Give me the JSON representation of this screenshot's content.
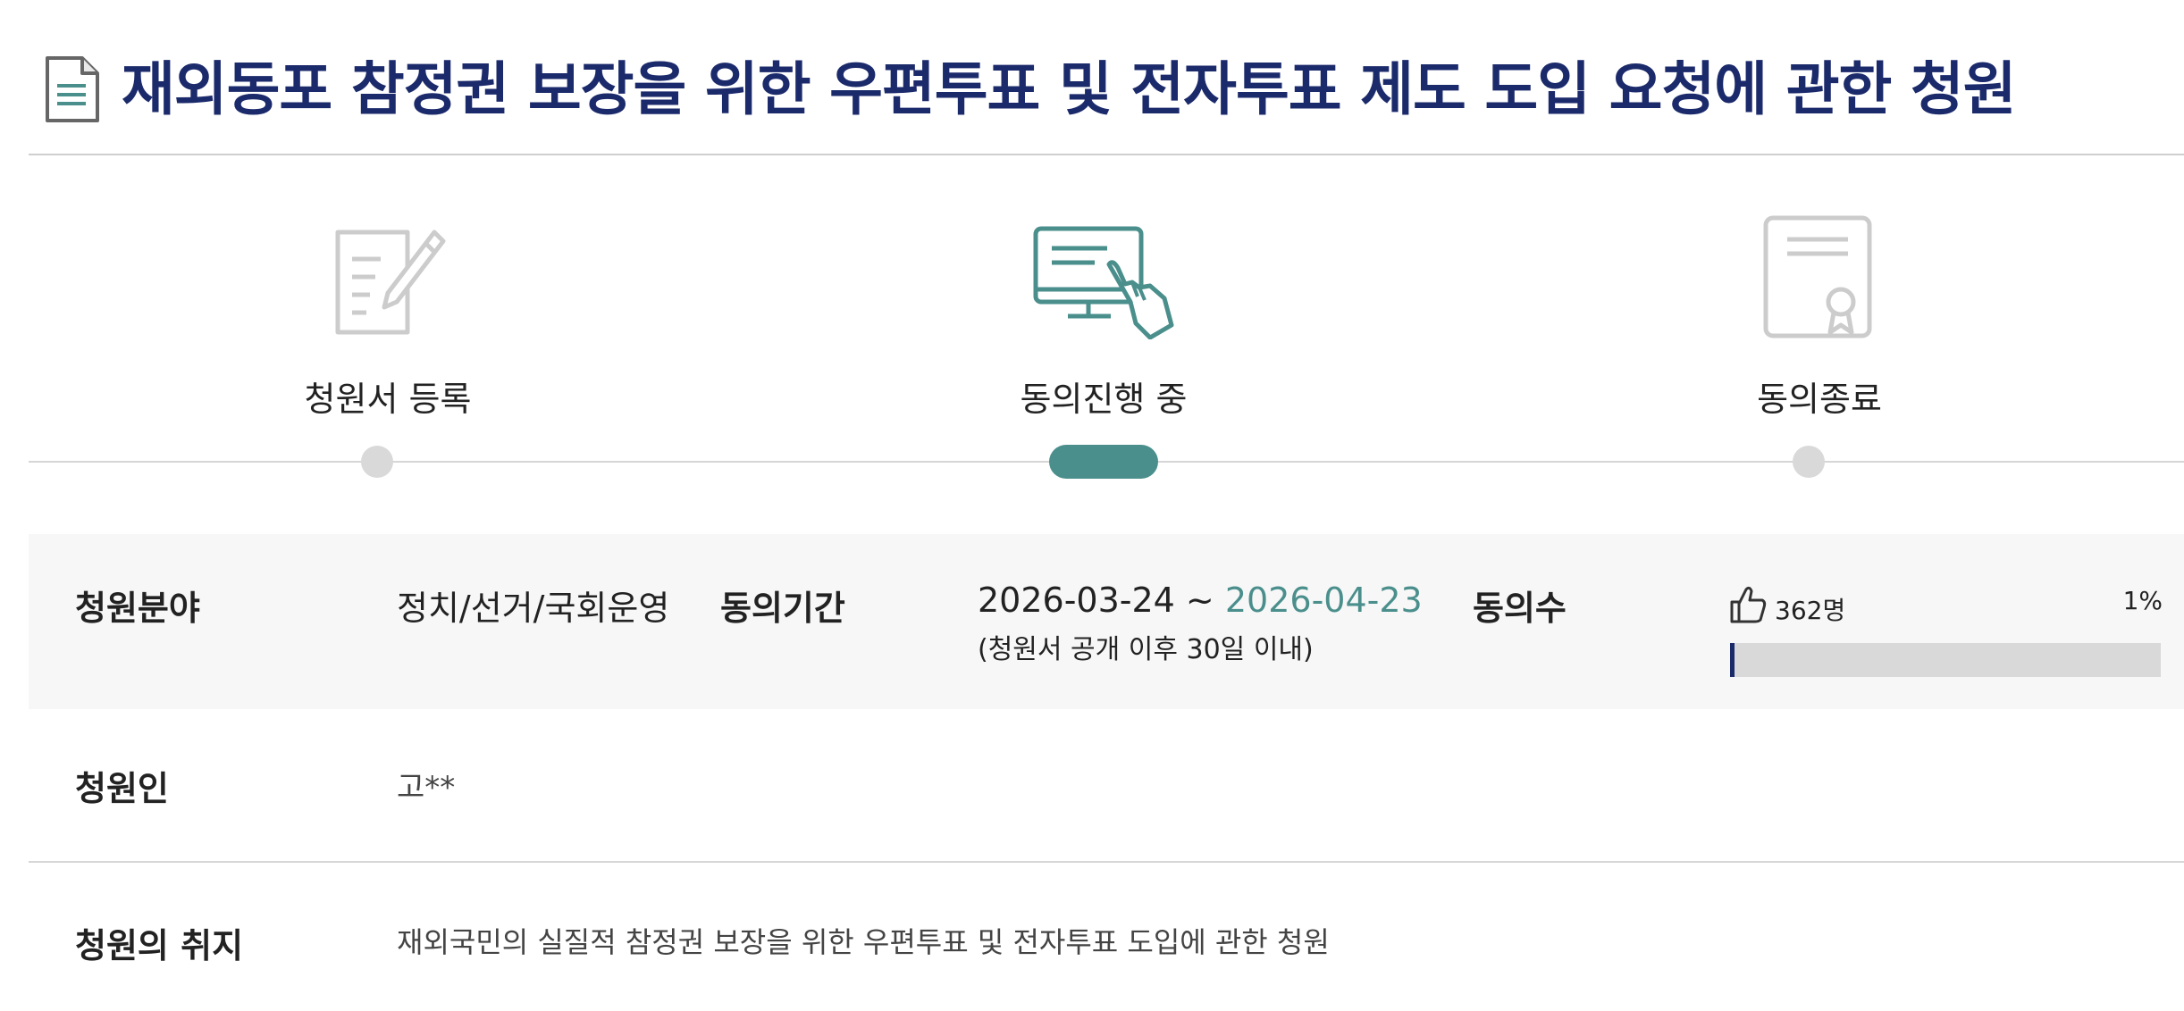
{
  "title": "재외동포 참정권 보장을 위한 우편투표 및 전자투표 제도 도입 요청에 관한 청원",
  "icons": {
    "title": "document-icon",
    "step1": "petition-write-icon",
    "step2": "monitor-touch-icon",
    "step3": "certificate-icon",
    "agree": "thumbs-up-icon"
  },
  "colors": {
    "title": "#1b2a6b",
    "accent": "#4a8f8c",
    "inactive": "#d9d9d9",
    "band": "#f7f7f7",
    "bar_fill": "#1b2a6b"
  },
  "steps": [
    {
      "label": "청원서 등록",
      "state": "done"
    },
    {
      "label": "동의진행 중",
      "state": "active"
    },
    {
      "label": "동의종료",
      "state": "pending"
    }
  ],
  "info": {
    "field_label": "청원분야",
    "field_value": "정치/선거/국회운영",
    "period_label": "동의기간",
    "period_start": "2026-03-24 ~",
    "period_end": "2026-04-23",
    "period_note": "(청원서 공개 이후 30일 이내)",
    "count_label": "동의수",
    "count_value": "362명",
    "percent": "1%",
    "progress_fraction": 0.01
  },
  "petitioner": {
    "label": "청원인",
    "value": "고**"
  },
  "purpose": {
    "label": "청원의 취지",
    "value": "재외국민의 실질적 참정권 보장을 위한 우편투표 및 전자투표 도입에 관한 청원"
  }
}
